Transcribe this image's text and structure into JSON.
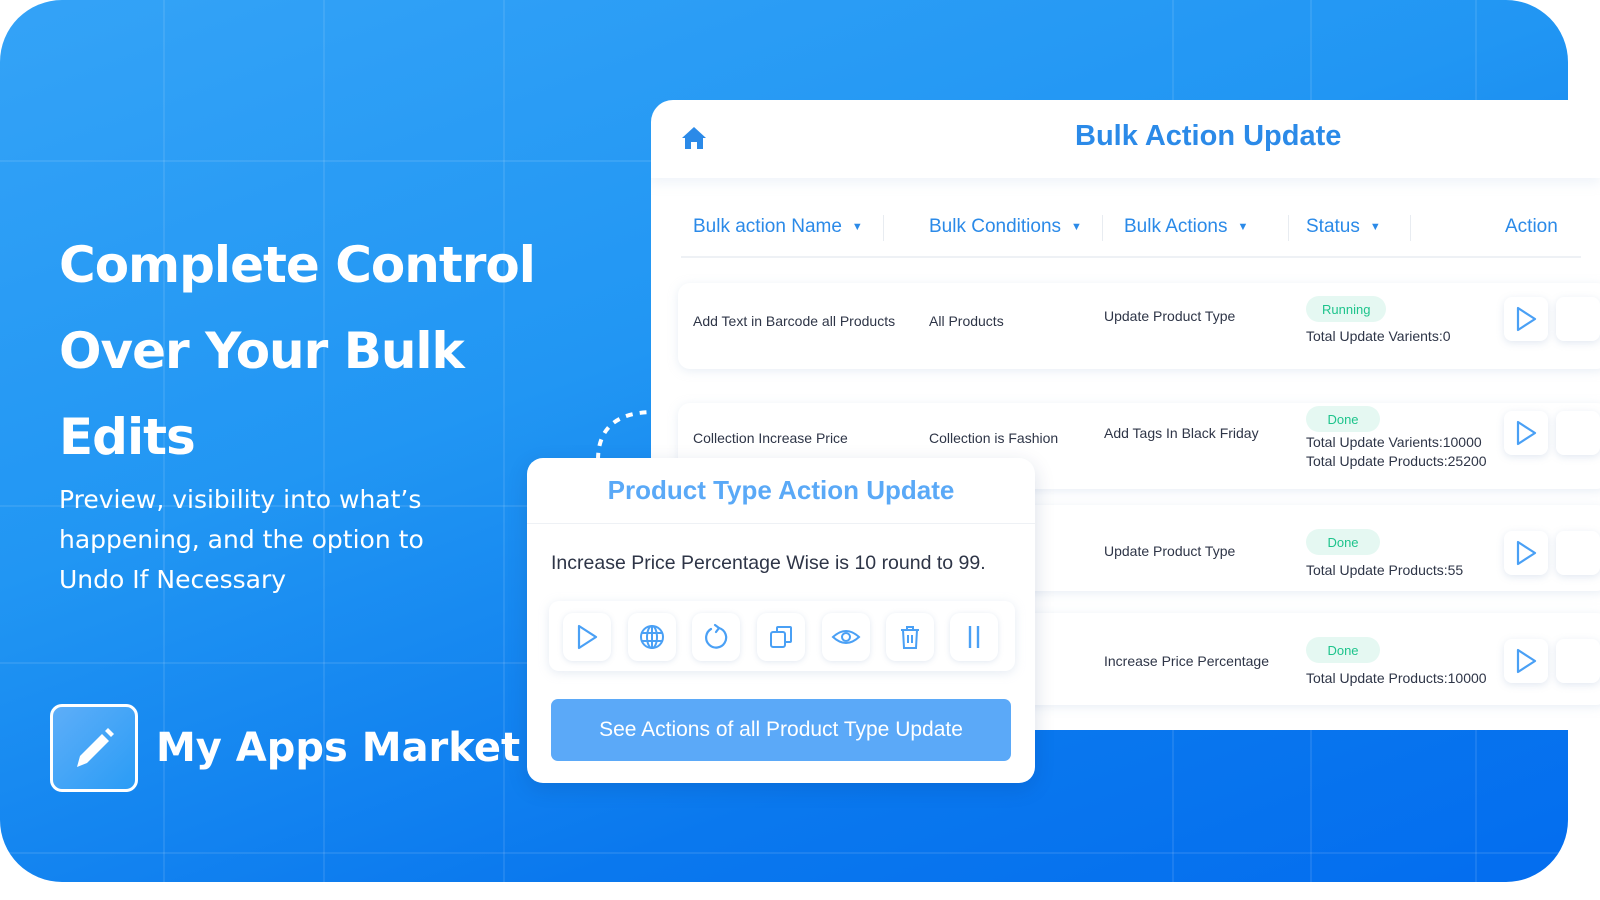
{
  "hero": {
    "headline_lines": [
      "Complete Control",
      "Over Your Bulk",
      "Edits"
    ],
    "subtext": "Preview, visibility into what’s happening, and the option to Undo If Necessary"
  },
  "brand": {
    "name": "My Apps Market",
    "icon": "pencil-icon"
  },
  "colors": {
    "accent": "#2b8ae8",
    "button": "#5ba9f8",
    "status_green": "#1ec48c",
    "status_bg": "#e5f8f2",
    "background_blue": "#2196f3"
  },
  "panel": {
    "title": "Bulk Action Update",
    "home_icon": "home-icon",
    "columns": [
      {
        "label": "Bulk action Name"
      },
      {
        "label": "Bulk Conditions"
      },
      {
        "label": "Bulk Actions"
      },
      {
        "label": "Status"
      },
      {
        "label": "Action"
      }
    ],
    "rows": [
      {
        "name": "Add Text in Barcode all Products",
        "condition": "All Products",
        "action": "Update Product Type",
        "status": "Running",
        "details": [
          "Total Update Varients:0"
        ]
      },
      {
        "name": "Collection Increase Price",
        "condition": "Collection is Fashion",
        "action": "Add Tags In Black Friday",
        "status": "Done",
        "details": [
          "Total Update Varients:10000",
          "Total Update Products:25200"
        ]
      },
      {
        "name": "",
        "condition": "",
        "action": "Update Product Type",
        "status": "Done",
        "details": [
          "Total Update Products:55"
        ]
      },
      {
        "name": "",
        "condition": "",
        "action": "Increase Price Percentage",
        "status": "Done",
        "details": [
          "Total Update Products:10000"
        ]
      }
    ]
  },
  "overlay": {
    "title": "Product Type Action Update",
    "description": "Increase Price Percentage Wise is 10 round to 99.",
    "tools": [
      "play-icon",
      "globe-icon",
      "refresh-icon",
      "copy-icon",
      "eye-icon",
      "trash-icon",
      "pause-icon"
    ],
    "button_label": "See Actions of all Product Type Update"
  }
}
